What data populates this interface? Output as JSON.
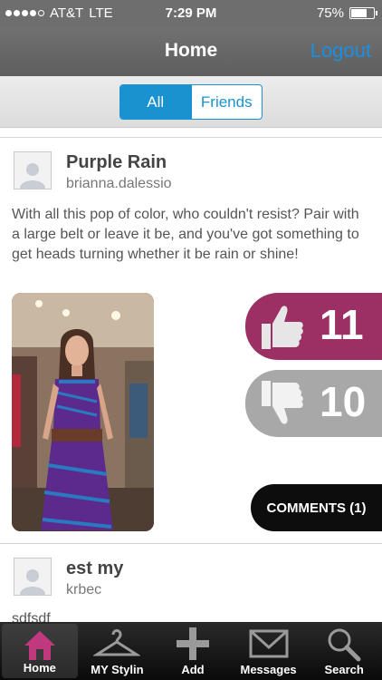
{
  "status_bar": {
    "carrier": "AT&T",
    "network": "LTE",
    "time": "7:29 PM",
    "battery_percent": "75%",
    "battery_level": 0.75,
    "signal_bars": 4
  },
  "nav": {
    "title": "Home",
    "logout_label": "Logout"
  },
  "segments": {
    "all_label": "All",
    "friends_label": "Friends",
    "selected": "All"
  },
  "posts": [
    {
      "title": "Purple Rain",
      "username": "brianna.dalessio",
      "text": "With all this pop of color, who couldn't resist? Pair with a large belt or leave it be, and you've got something to get heads turning whether it be rain or shine!",
      "likes": "11",
      "dislikes": "10",
      "comments_label": "COMMENTS (1)"
    },
    {
      "title": "est my",
      "username": "krbec",
      "text": "sdfsdf"
    }
  ],
  "tab_bar": {
    "items": [
      {
        "label": "Home",
        "icon": "house-icon"
      },
      {
        "label": "MY Stylin",
        "icon": "hanger-icon"
      },
      {
        "label": "Add",
        "icon": "plus-icon"
      },
      {
        "label": "Messages",
        "icon": "envelope-icon"
      },
      {
        "label": "Search",
        "icon": "magnifier-icon"
      }
    ],
    "active": "Home"
  },
  "colors": {
    "accent": "#1a92d0",
    "like": "#9c2f64",
    "dislike": "#a8a8a8",
    "active_tab_icon": "#c0397e"
  }
}
